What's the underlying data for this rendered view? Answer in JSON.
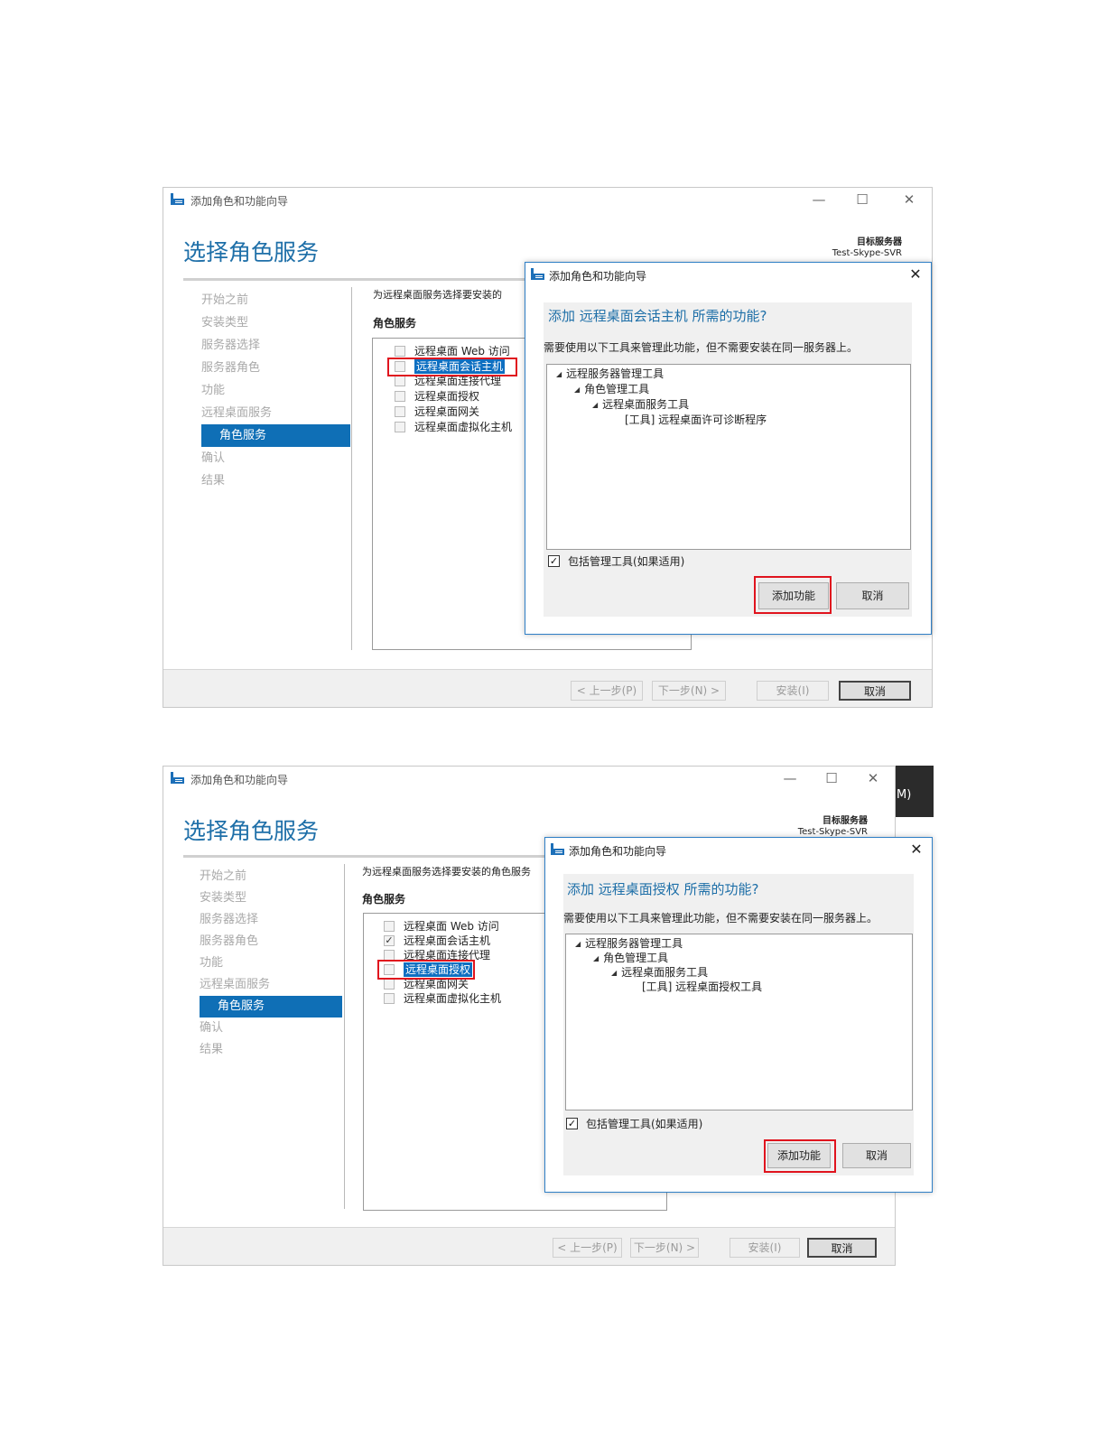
{
  "screenshots": [
    {
      "window": {
        "title": "添加角色和功能向导",
        "minimize": "—",
        "maximize": "☐",
        "close": "✕",
        "heading": "选择角色服务",
        "target_label": "目标服务器",
        "target_server": "Test-Skype-SVR",
        "steps": [
          "开始之前",
          "安装类型",
          "服务器选择",
          "服务器角色",
          "功能",
          "远程桌面服务",
          "角色服务",
          "确认",
          "结果"
        ],
        "active_step": "角色服务",
        "description": "为远程桌面服务选择要安装的",
        "section_label": "角色服务",
        "role_services": [
          {
            "label": "远程桌面 Web 访问",
            "checked": false
          },
          {
            "label": "远程桌面会话主机",
            "checked": false
          },
          {
            "label": "远程桌面连接代理",
            "checked": false
          },
          {
            "label": "远程桌面授权",
            "checked": false
          },
          {
            "label": "远程桌面网关",
            "checked": false
          },
          {
            "label": "远程桌面虚拟化主机",
            "checked": false
          }
        ],
        "buttons": {
          "prev": "< 上一步(P)",
          "next": "下一步(N) >",
          "install": "安装(I)",
          "cancel": "取消"
        }
      },
      "dialog": {
        "title": "添加角色和功能向导",
        "close": "✕",
        "question": "添加 远程桌面会话主机 所需的功能?",
        "description": "需要使用以下工具来管理此功能，但不需要安装在同一服务器上。",
        "tree": [
          "远程服务器管理工具",
          "角色管理工具",
          "远程桌面服务工具",
          "[工具] 远程桌面许可诊断程序"
        ],
        "include_tools": "包括管理工具(如果适用)",
        "include_checked": true,
        "add_button": "添加功能",
        "cancel_button": "取消"
      }
    },
    {
      "window": {
        "title": "添加角色和功能向导",
        "minimize": "—",
        "maximize": "☐",
        "close": "✕",
        "heading": "选择角色服务",
        "target_label": "目标服务器",
        "target_server": "Test-Skype-SVR",
        "steps": [
          "开始之前",
          "安装类型",
          "服务器选择",
          "服务器角色",
          "功能",
          "远程桌面服务",
          "角色服务",
          "确认",
          "结果"
        ],
        "active_step": "角色服务",
        "description": "为远程桌面服务选择要安装的角色服务",
        "section_label": "角色服务",
        "role_services": [
          {
            "label": "远程桌面 Web 访问",
            "checked": false
          },
          {
            "label": "远程桌面会话主机",
            "checked": true
          },
          {
            "label": "远程桌面连接代理",
            "checked": false
          },
          {
            "label": "远程桌面授权",
            "checked": false
          },
          {
            "label": "远程桌面网关",
            "checked": false
          },
          {
            "label": "远程桌面虚拟化主机",
            "checked": false
          }
        ],
        "buttons": {
          "prev": "< 上一步(P)",
          "next": "下一步(N) >",
          "install": "安装(I)",
          "cancel": "取消"
        },
        "background_fragment": "M)"
      },
      "dialog": {
        "title": "添加角色和功能向导",
        "close": "✕",
        "question": "添加 远程桌面授权 所需的功能?",
        "description": "需要使用以下工具来管理此功能，但不需要安装在同一服务器上。",
        "tree": [
          "远程服务器管理工具",
          "角色管理工具",
          "远程桌面服务工具",
          "[工具] 远程桌面授权工具"
        ],
        "include_tools": "包括管理工具(如果适用)",
        "include_checked": true,
        "add_button": "添加功能",
        "cancel_button": "取消"
      }
    }
  ],
  "colors": {
    "accent": "#1e6fa8",
    "selection": "#0f6fb6",
    "highlight": "#e0141e"
  },
  "icons": {
    "app": "server-manager-icon",
    "tree_expand": "triangle-down-icon",
    "check": "checkmark-icon"
  }
}
